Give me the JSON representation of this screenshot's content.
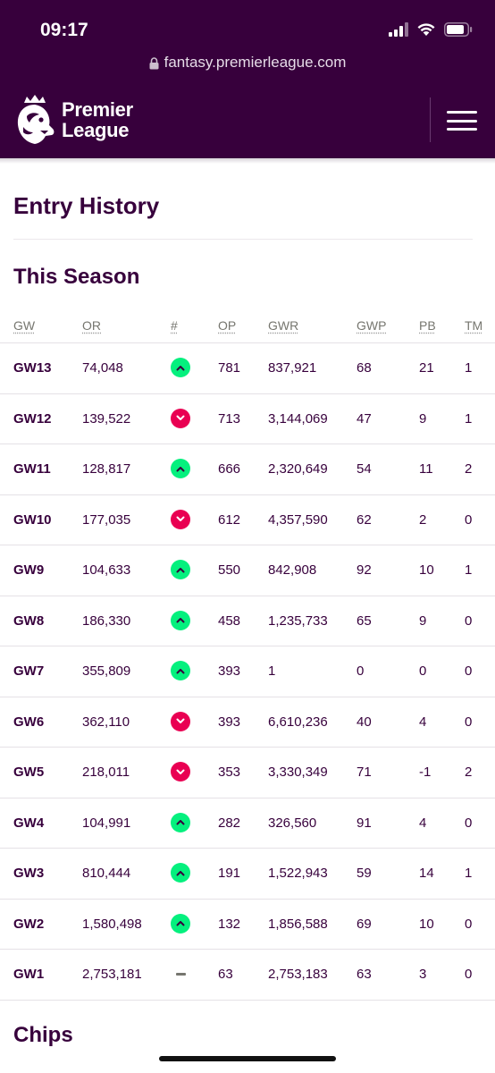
{
  "status_bar": {
    "time": "09:17"
  },
  "browser": {
    "url": "fantasy.premierleague.com"
  },
  "header": {
    "logo_line1": "Premier",
    "logo_line2": "League"
  },
  "page": {
    "title": "Entry History",
    "section_title": "This Season",
    "next_section": "Chips"
  },
  "table": {
    "columns": [
      "GW",
      "OR",
      "#",
      "OP",
      "GWR",
      "GWP",
      "PB",
      "TM"
    ],
    "rows": [
      {
        "gw": "GW13",
        "or": "74,048",
        "move": "up",
        "op": "781",
        "gwr": "837,921",
        "gwp": "68",
        "pb": "21",
        "tm": "1"
      },
      {
        "gw": "GW12",
        "or": "139,522",
        "move": "down",
        "op": "713",
        "gwr": "3,144,069",
        "gwp": "47",
        "pb": "9",
        "tm": "1"
      },
      {
        "gw": "GW11",
        "or": "128,817",
        "move": "up",
        "op": "666",
        "gwr": "2,320,649",
        "gwp": "54",
        "pb": "11",
        "tm": "2"
      },
      {
        "gw": "GW10",
        "or": "177,035",
        "move": "down",
        "op": "612",
        "gwr": "4,357,590",
        "gwp": "62",
        "pb": "2",
        "tm": "0"
      },
      {
        "gw": "GW9",
        "or": "104,633",
        "move": "up",
        "op": "550",
        "gwr": "842,908",
        "gwp": "92",
        "pb": "10",
        "tm": "1"
      },
      {
        "gw": "GW8",
        "or": "186,330",
        "move": "up",
        "op": "458",
        "gwr": "1,235,733",
        "gwp": "65",
        "pb": "9",
        "tm": "0"
      },
      {
        "gw": "GW7",
        "or": "355,809",
        "move": "up",
        "op": "393",
        "gwr": "1",
        "gwp": "0",
        "pb": "0",
        "tm": "0"
      },
      {
        "gw": "GW6",
        "or": "362,110",
        "move": "down",
        "op": "393",
        "gwr": "6,610,236",
        "gwp": "40",
        "pb": "4",
        "tm": "0"
      },
      {
        "gw": "GW5",
        "or": "218,011",
        "move": "down",
        "op": "353",
        "gwr": "3,330,349",
        "gwp": "71",
        "pb": "-1",
        "tm": "2"
      },
      {
        "gw": "GW4",
        "or": "104,991",
        "move": "up",
        "op": "282",
        "gwr": "326,560",
        "gwp": "91",
        "pb": "4",
        "tm": "0"
      },
      {
        "gw": "GW3",
        "or": "810,444",
        "move": "up",
        "op": "191",
        "gwr": "1,522,943",
        "gwp": "59",
        "pb": "14",
        "tm": "1"
      },
      {
        "gw": "GW2",
        "or": "1,580,498",
        "move": "up",
        "op": "132",
        "gwr": "1,856,588",
        "gwp": "69",
        "pb": "10",
        "tm": "0"
      },
      {
        "gw": "GW1",
        "or": "2,753,181",
        "move": "same",
        "op": "63",
        "gwr": "2,753,183",
        "gwp": "63",
        "pb": "3",
        "tm": "0"
      }
    ]
  },
  "colors": {
    "brand": "#37003c",
    "up": "#05f07e",
    "down": "#e90052"
  },
  "icons": {
    "up": "chevron-up-icon",
    "down": "chevron-down-icon",
    "same": "dash-icon"
  }
}
